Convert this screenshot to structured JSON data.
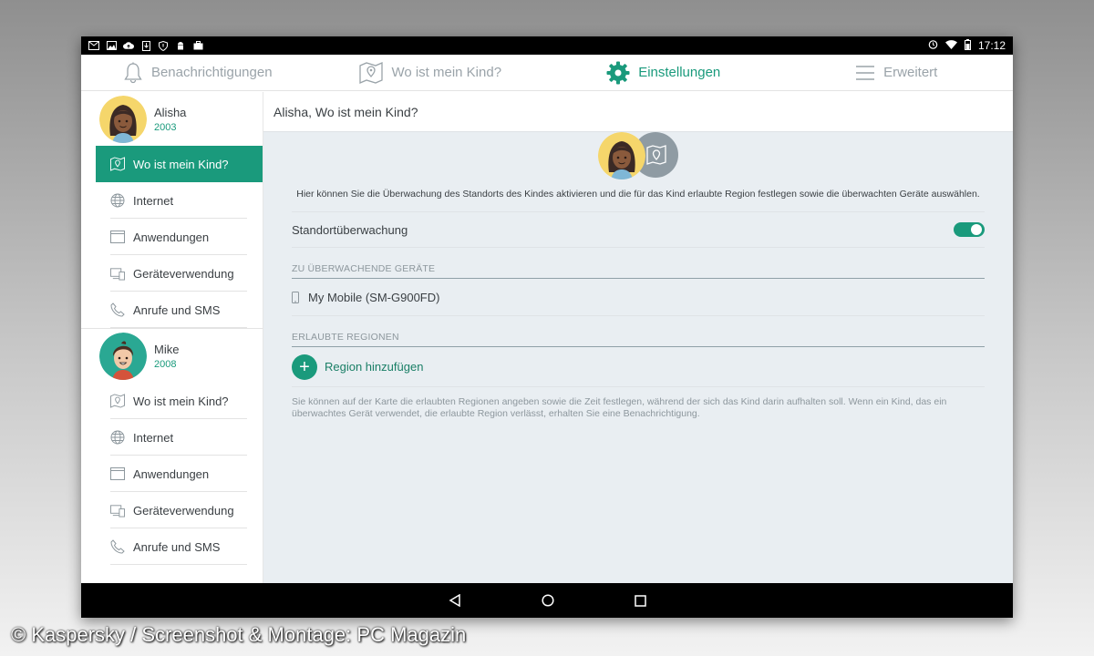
{
  "status_bar": {
    "left_icons": [
      "mail-icon",
      "image-icon",
      "cloud-upload-icon",
      "download-icon",
      "shield-icon",
      "android-icon",
      "briefcase-icon"
    ],
    "right_icons": [
      "alarm-icon",
      "wifi-icon",
      "battery-icon"
    ],
    "time": "17:12"
  },
  "top_nav": {
    "tabs": [
      {
        "label": "Benachrichtigungen",
        "icon": "bell-icon"
      },
      {
        "label": "Wo ist mein Kind?",
        "icon": "map-pin-icon"
      },
      {
        "label": "Einstellungen",
        "icon": "gear-icon",
        "active": true
      },
      {
        "label": "Erweitert",
        "icon": "menu-icon"
      }
    ]
  },
  "sidebar": {
    "children": [
      {
        "name": "Alisha",
        "year": "2003",
        "items": [
          {
            "label": "Wo ist mein Kind?",
            "icon": "map-pin-icon",
            "active": true
          },
          {
            "label": "Internet",
            "icon": "globe-icon"
          },
          {
            "label": "Anwendungen",
            "icon": "window-icon"
          },
          {
            "label": "Geräteverwendung",
            "icon": "devices-icon"
          },
          {
            "label": "Anrufe und SMS",
            "icon": "phone-icon"
          }
        ]
      },
      {
        "name": "Mike",
        "year": "2008",
        "items": [
          {
            "label": "Wo ist mein Kind?",
            "icon": "map-pin-icon"
          },
          {
            "label": "Internet",
            "icon": "globe-icon"
          },
          {
            "label": "Anwendungen",
            "icon": "window-icon"
          },
          {
            "label": "Geräteverwendung",
            "icon": "devices-icon"
          },
          {
            "label": "Anrufe und SMS",
            "icon": "phone-icon"
          }
        ]
      }
    ]
  },
  "content": {
    "header": "Alisha, Wo ist mein Kind?",
    "description": "Hier können Sie die Überwachung des Standorts des Kindes aktivieren und die für das Kind erlaubte Region festlegen sowie die überwachten Geräte auswählen.",
    "toggle_label": "Standortüberwachung",
    "toggle_on": true,
    "devices_heading": "ZU ÜBERWACHENDE GERÄTE",
    "device_name": "My Mobile (SM-G900FD)",
    "regions_heading": "ERLAUBTE REGIONEN",
    "add_region_label": "Region hinzufügen",
    "note": "Sie können auf der Karte die erlaubten Regionen angeben sowie die Zeit festlegen, während der sich das Kind darin aufhalten soll. Wenn ein Kind, das ein überwachtes Gerät verwendet, die erlaubte Region verlässt, erhalten Sie eine Benachrichtigung."
  },
  "nav_bar": {
    "buttons": [
      "back-icon",
      "home-icon",
      "recents-icon"
    ]
  },
  "watermark": "© Kaspersky / Screenshot & Montage: PC Magazin",
  "colors": {
    "accent": "#1a9a7c",
    "content_bg": "#e9eef2",
    "inactive_tab": "#9aa3a9"
  }
}
